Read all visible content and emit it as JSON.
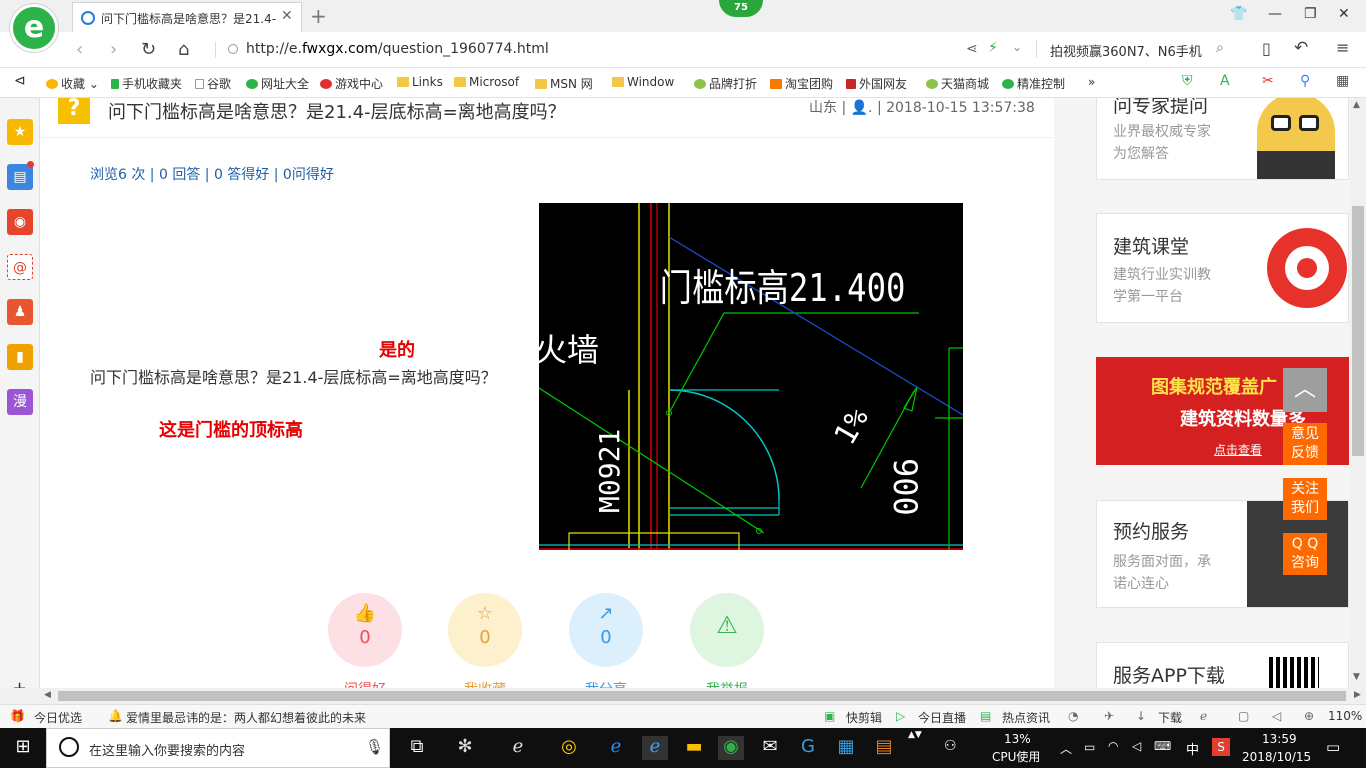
{
  "browser": {
    "tab_title": "问下门槛标高是啥意思？是21.4-",
    "url_prefix": "http://e.",
    "url_domain": "fwxgx.com",
    "url_path": "/question_1960774.html",
    "badge_count": "75",
    "search_text": "拍视频赢360N7、N6手机",
    "new_tab": "+",
    "logo_letter": "e"
  },
  "bookmarks": {
    "items": [
      "收藏",
      "手机收藏夹",
      "谷歌",
      "网址大全",
      "游戏中心",
      "Links",
      "Microsof",
      "MSN 网",
      "Window",
      "品牌打折",
      "淘宝团购",
      "外国网友",
      "天猫商城",
      "精准控制"
    ],
    "more": "»"
  },
  "sidebar": {
    "items": [
      {
        "icon": "star-icon",
        "color": "#f6b800",
        "glyph": "★"
      },
      {
        "icon": "news-icon",
        "color": "#3a86e0",
        "glyph": "▤"
      },
      {
        "icon": "weibo-icon",
        "color": "#e6452b",
        "glyph": "◉"
      },
      {
        "icon": "mail-icon",
        "color": "#e03f2f",
        "glyph": "@"
      },
      {
        "icon": "game-icon",
        "color": "#e8552e",
        "glyph": "♟"
      },
      {
        "icon": "book-icon",
        "color": "#f0a000",
        "glyph": "▮"
      },
      {
        "icon": "manga-icon",
        "color": "#9a56d4",
        "glyph": "漫"
      }
    ],
    "add": "+"
  },
  "question": {
    "mark": "?",
    "title": "问下门槛标高是啥意思？是21.4-层底标高=离地高度吗？",
    "meta": "山东 | 👤. | 2018-10-15 13:57:38",
    "stats": "浏览6 次 | 0 回答 | 0 答得好 | 0问得好",
    "body": "问下门槛标高是啥意思？是21.4-层底标高=离地高度吗？",
    "red_yes": "是的",
    "red_answer": "这是门槛的顶标高"
  },
  "cad": {
    "label_main": "门槛标高21.400",
    "label_wall": "火墙",
    "label_door": "M0921",
    "label_slope": "1%",
    "label_dim": "900"
  },
  "actions": [
    {
      "name": "like",
      "icon": "thumb-up-icon",
      "count": "0",
      "label": "问得好",
      "bg": "#fde0e3",
      "fg": "#e8505b",
      "glyph": "👍"
    },
    {
      "name": "favorite",
      "icon": "star-icon",
      "count": "0",
      "label": "我收藏",
      "bg": "#fdf0cc",
      "fg": "#e4a13a",
      "glyph": "☆"
    },
    {
      "name": "share",
      "icon": "share-icon",
      "count": "0",
      "label": "我分享",
      "bg": "#dceffc",
      "fg": "#3a9ae0",
      "glyph": "↗"
    },
    {
      "name": "report",
      "icon": "warning-icon",
      "count": "",
      "label": "我举报",
      "bg": "#def5e0",
      "fg": "#3bb155",
      "glyph": "⚠"
    }
  ],
  "right": {
    "card1_title": "问专家提问",
    "card1_sub1": "业界最权威专家",
    "card1_sub2": "为您解答",
    "card2_title": "建筑课堂",
    "card2_sub1": "建筑行业实训教",
    "card2_sub2": "学第一平台",
    "promo_1": "图集规范覆盖广",
    "promo_2": "建筑资料数量多",
    "promo_3": "点击查看",
    "card3_title": "预约服务",
    "card3_sub1": "服务面对面，承",
    "card3_sub2": "诺心连心",
    "card4_title": "服务APP下载"
  },
  "float_buttons": {
    "top": "︿",
    "feedback": [
      "意见",
      "反馈"
    ],
    "follow": [
      "关注",
      "我们"
    ],
    "qq": [
      "Q Q",
      "咨询"
    ]
  },
  "statusbar": {
    "today": "今日优选",
    "headline": "爱情里最忌讳的是：两人都幻想着彼此的未来",
    "quickclip": "快剪辑",
    "live": "今日直播",
    "hotnews": "热点资讯",
    "download": "下载",
    "zoom": "110%"
  },
  "taskbar": {
    "search_placeholder": "在这里输入你要搜索的内容",
    "cpu_pct": "13%",
    "cpu_label": "CPU使用",
    "ime": "中",
    "time": "13:59",
    "date": "2018/10/15"
  }
}
